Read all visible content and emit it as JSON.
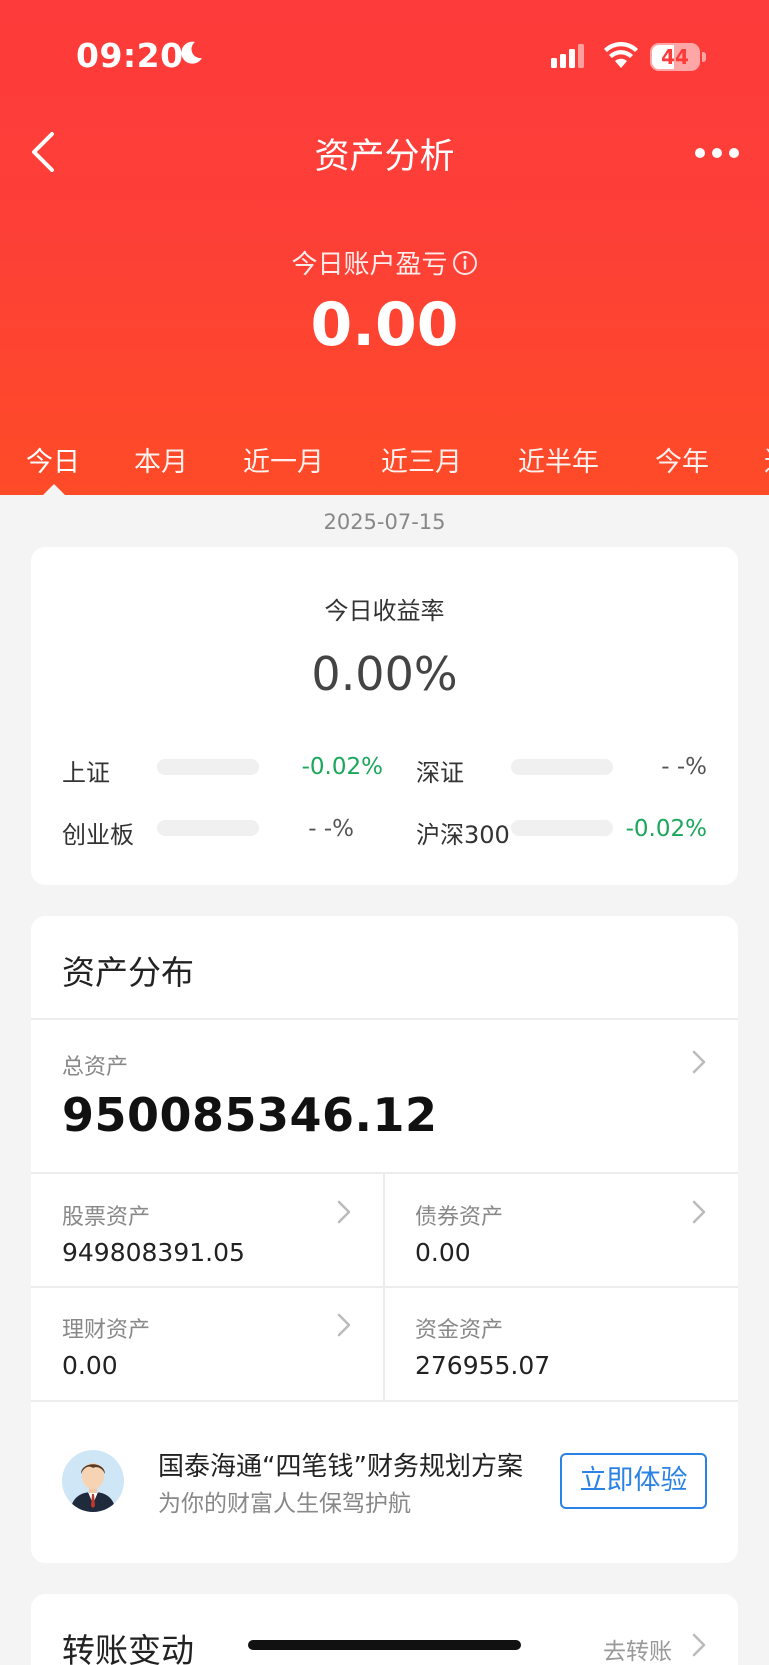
{
  "status": {
    "time": "09:20",
    "battery": "44"
  },
  "nav": {
    "title": "资产分析"
  },
  "pnl": {
    "label": "今日账户盈亏",
    "value": "0.00"
  },
  "tabs": [
    "今日",
    "本月",
    "近一月",
    "近三月",
    "近半年",
    "今年",
    "近"
  ],
  "date": "2025-07-15",
  "daily_return": {
    "label": "今日收益率",
    "value": "0.00%",
    "indices": [
      {
        "name": "上证",
        "value": "-0.02%",
        "color": "#1aa75b"
      },
      {
        "name": "深证",
        "value": "- -%",
        "color": "#555555"
      },
      {
        "name": "创业板",
        "value": "- -%",
        "color": "#555555"
      },
      {
        "name": "沪深300",
        "value": "-0.02%",
        "color": "#1aa75b"
      }
    ]
  },
  "assets": {
    "title": "资产分布",
    "total_label": "总资产",
    "total_value": "950085346.12",
    "items": [
      {
        "label": "股票资产",
        "value": "949808391.05"
      },
      {
        "label": "债券资产",
        "value": "0.00"
      },
      {
        "label": "理财资产",
        "value": "0.00"
      },
      {
        "label": "资金资产",
        "value": "276955.07"
      }
    ]
  },
  "promo": {
    "title": "国泰海通“四笔钱”财务规划方案",
    "subtitle": "为你的财富人生保驾护航",
    "button": "立即体验"
  },
  "transfer": {
    "title": "转账变动",
    "link": "去转账"
  },
  "colors": {
    "header_top": "#fd3b3b",
    "header_bottom": "#fe4b27",
    "green": "#1aa75b",
    "link_blue": "#2a82e4"
  }
}
